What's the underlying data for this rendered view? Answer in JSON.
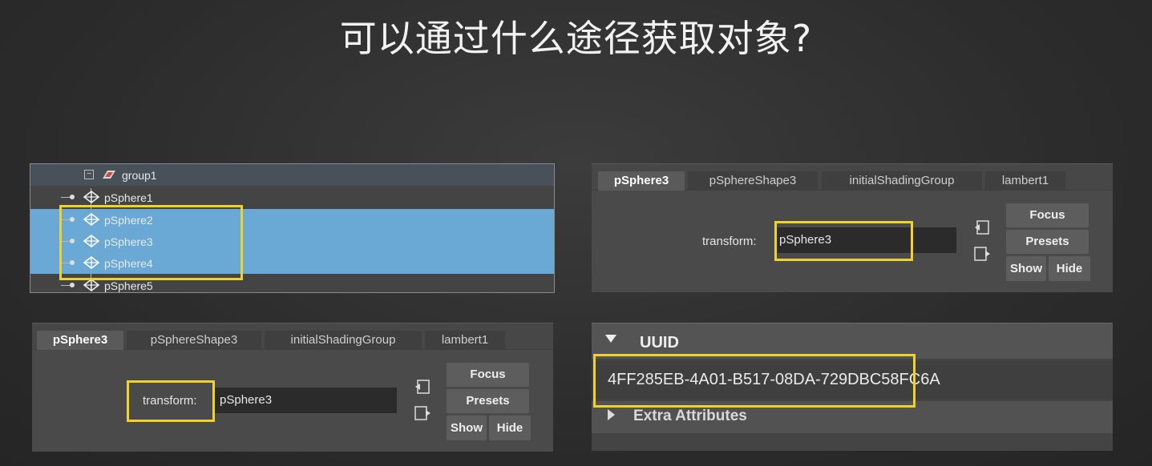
{
  "title": "可以通过什么途径获取对象?",
  "outliner": {
    "group_label": "group1",
    "items": [
      {
        "label": "pSphere1",
        "selected": false
      },
      {
        "label": "pSphere2",
        "selected": true
      },
      {
        "label": "pSphere3",
        "selected": true
      },
      {
        "label": "pSphere4",
        "selected": true
      },
      {
        "label": "pSphere5",
        "selected": false
      }
    ]
  },
  "attribute_editor_top": {
    "tabs": [
      "pSphere3",
      "pSphereShape3",
      "initialShadingGroup",
      "lambert1"
    ],
    "active_tab": "pSphere3",
    "transform_label": "transform:",
    "transform_value": "pSphere3",
    "focus_button": "Focus",
    "presets_button": "Presets",
    "show_button": "Show",
    "hide_button": "Hide"
  },
  "attribute_editor_bottom": {
    "tabs": [
      "pSphere3",
      "pSphereShape3",
      "initialShadingGroup",
      "lambert1"
    ],
    "active_tab": "pSphere3",
    "transform_label": "transform:",
    "transform_value": "pSphere3",
    "focus_button": "Focus",
    "presets_button": "Presets",
    "show_button": "Show",
    "hide_button": "Hide"
  },
  "uuid_section": {
    "header": "UUID",
    "value": "4FF285EB-4A01-B517-08DA-729DBC58FC6A",
    "extra_header": "Extra Attributes"
  },
  "colors": {
    "highlight": "#f0d22a",
    "selection": "#6aa9d6"
  }
}
